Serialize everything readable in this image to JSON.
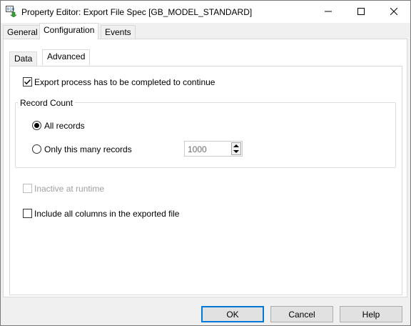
{
  "window": {
    "title": "Property Editor: Export File Spec [GB_MODEL_STANDARD]",
    "app_icon": "export-file-spec-icon",
    "caption_buttons": [
      "minimize-icon",
      "maximize-icon",
      "close-icon"
    ]
  },
  "outer_tabs": [
    {
      "label": "General",
      "active": false
    },
    {
      "label": "Configuration",
      "active": true
    },
    {
      "label": "Events",
      "active": false
    }
  ],
  "inner_tabs": [
    {
      "label": "Data",
      "active": false
    },
    {
      "label": "Advanced",
      "active": true
    }
  ],
  "advanced": {
    "export_complete": {
      "label": "Export process has to be completed to continue",
      "checked": true
    },
    "record_count": {
      "title": "Record Count",
      "all_records": {
        "label": "All records",
        "selected": true
      },
      "only_this_many": {
        "label": "Only this many records",
        "selected": false
      },
      "count_value": "1000"
    },
    "inactive_runtime": {
      "label": "Inactive at runtime",
      "checked": false,
      "enabled": false
    },
    "include_all_columns": {
      "label": "Include all columns in the exported file",
      "checked": false
    }
  },
  "footer": {
    "ok_label": "OK",
    "cancel_label": "Cancel",
    "help_label": "Help"
  },
  "colors": {
    "default_button_border": "#0078d7",
    "disabled_text": "#a0a0a0"
  }
}
